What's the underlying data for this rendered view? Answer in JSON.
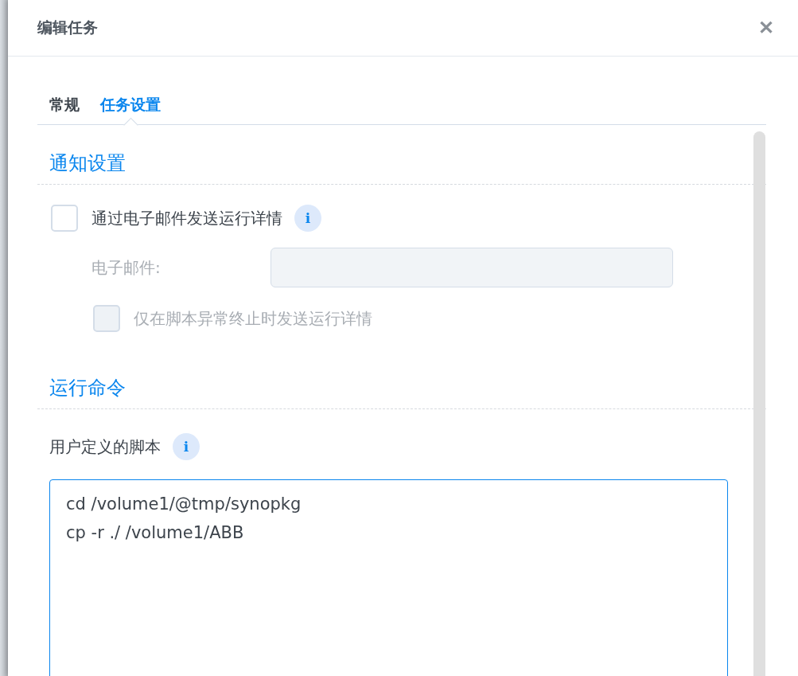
{
  "dialog": {
    "title": "编辑任务",
    "close_label": "✕"
  },
  "tabs": [
    {
      "label": "常规",
      "selected": false
    },
    {
      "label": "任务设置",
      "selected": true
    }
  ],
  "notification": {
    "heading": "通知设置",
    "email_details": {
      "label": "通过电子邮件发送运行详情",
      "checked": false,
      "info": "i"
    },
    "email_field": {
      "label": "电子邮件:",
      "disabled": true
    },
    "only_on_error": {
      "label": "仅在脚本异常终止时发送运行详情",
      "checked": false,
      "disabled": true
    }
  },
  "run_command": {
    "heading": "运行命令",
    "script_label": "用户定义的脚本",
    "info": "i",
    "script": "cd /volume1/@tmp/synopkg\ncp -r ./ /volume1/ABB"
  }
}
